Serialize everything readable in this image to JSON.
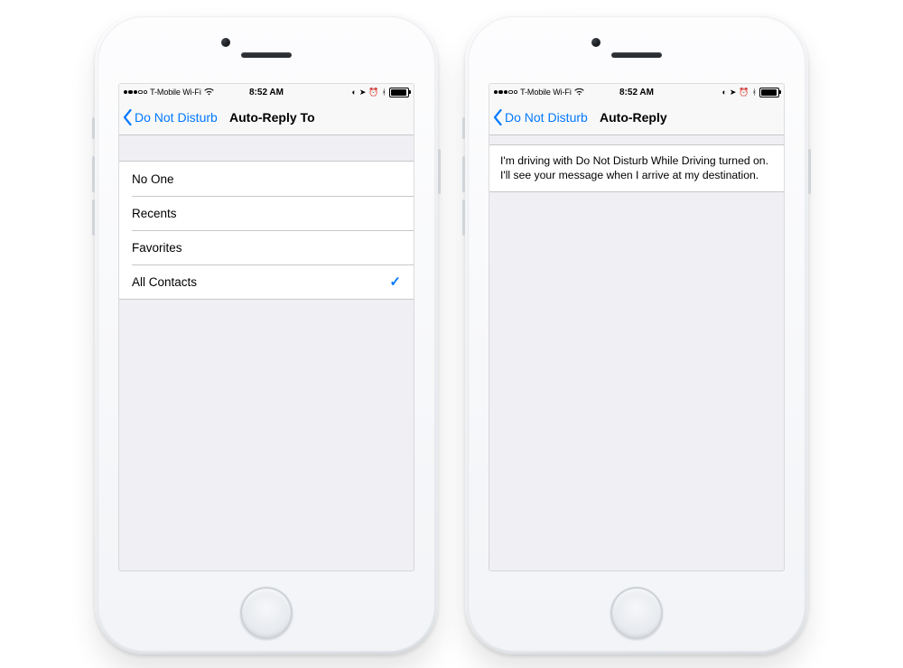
{
  "statusBar": {
    "carrier": "T-Mobile Wi-Fi",
    "time": "8:52 AM",
    "signalFilled": 3,
    "signalTotal": 5
  },
  "leftPhone": {
    "nav": {
      "back": "Do Not Disturb",
      "title": "Auto-Reply To"
    },
    "options": [
      {
        "label": "No One",
        "selected": false
      },
      {
        "label": "Recents",
        "selected": false
      },
      {
        "label": "Favorites",
        "selected": false
      },
      {
        "label": "All Contacts",
        "selected": true
      }
    ]
  },
  "rightPhone": {
    "nav": {
      "back": "Do Not Disturb",
      "title": "Auto-Reply"
    },
    "message": "I'm driving with Do Not Disturb While Driving turned on. I'll see your message when I arrive at my destination."
  },
  "icons": {
    "checkmark": "✓"
  }
}
